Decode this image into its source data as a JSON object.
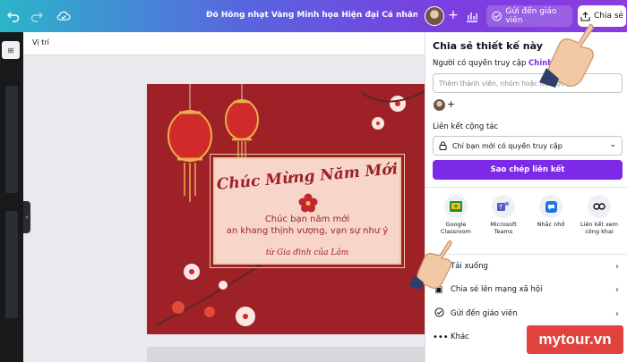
{
  "topbar": {
    "title": "Đỏ Hồng nhạt Vàng Minh họa Hiện đại Cá nhân Khổ ngang ...",
    "send_label": "Gửi đến giáo viên",
    "share_label": "Chia sẻ",
    "gradient": [
      "#2bb5c9",
      "#5a63e0",
      "#8b3bdf"
    ]
  },
  "canvas": {
    "toolbar_label": "Vị trí"
  },
  "design": {
    "title": "Chúc Mừng Năm Mới",
    "line1": "Chúc bạn năm mới",
    "line2": "an khang thịnh vượng, vạn sự như ý",
    "from": "từ Gia đình của Lâm",
    "bg_color": "#9d2127",
    "frame_color": "#f7d6c9"
  },
  "share_panel": {
    "title": "Chia sẻ thiết kế này",
    "access_label": "Người có quyền truy cập",
    "access_edit": "Chỉnh sửa",
    "input_placeholder": "Thêm thành viên, nhóm hoặc lớp học",
    "collab_label": "Liên kết cộng tác",
    "collab_value": "Chỉ bạn mới có quyền truy cập",
    "copy_button": "Sao chép liên kết",
    "accent": "#7d2ae8",
    "apps": [
      {
        "label": "Google Classroom",
        "icon": "google-classroom-icon"
      },
      {
        "label": "Microsoft Teams",
        "icon": "microsoft-teams-icon"
      },
      {
        "label": "Nhắc nhở",
        "icon": "remind-icon"
      },
      {
        "label": "Liên kết xem công khai",
        "icon": "link-icon"
      }
    ],
    "actions": [
      {
        "label": "Tải xuống",
        "icon": "download-icon"
      },
      {
        "label": "Chia sẻ lên mạng xã hội",
        "icon": "share-social-icon"
      },
      {
        "label": "Gửi đến giáo viên",
        "icon": "check-circle-icon"
      },
      {
        "label": "Khác",
        "icon": "more-icon"
      }
    ]
  },
  "watermark": "mytour.vn"
}
